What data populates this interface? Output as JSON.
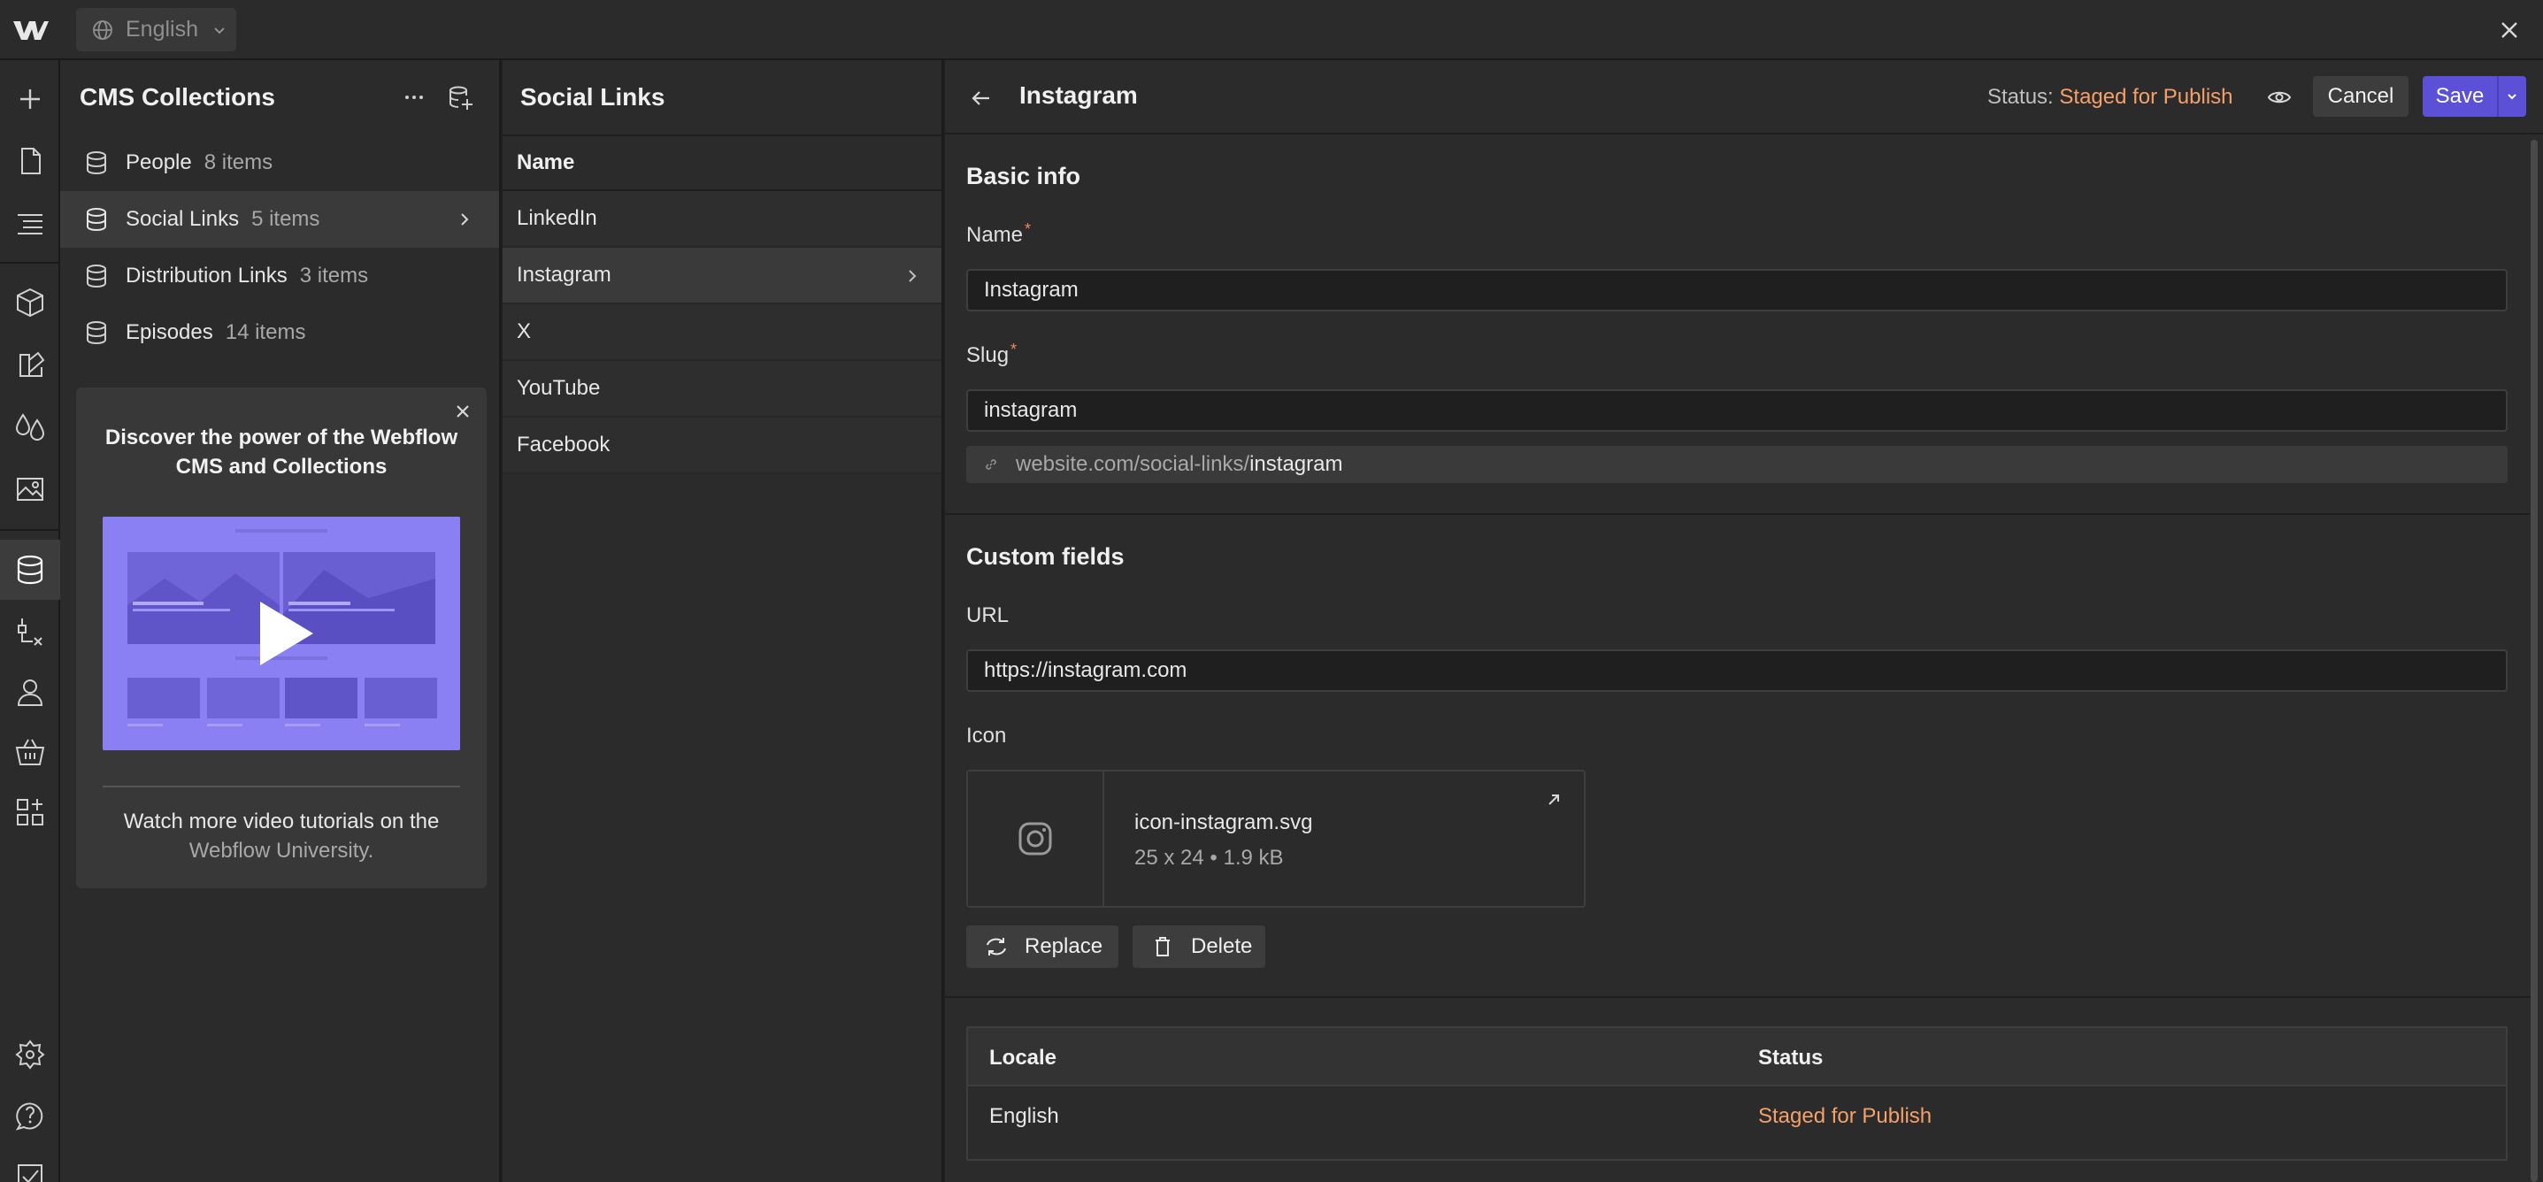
{
  "topbar": {
    "locale": "English"
  },
  "collections": {
    "title": "CMS Collections",
    "items": [
      {
        "name": "People",
        "count": "8 items"
      },
      {
        "name": "Social Links",
        "count": "5 items"
      },
      {
        "name": "Distribution Links",
        "count": "3 items"
      },
      {
        "name": "Episodes",
        "count": "14 items"
      }
    ],
    "promo": {
      "title": "Discover the power of the Webflow CMS and Collections",
      "footer_prefix": "Watch more video tutorials on the",
      "footer_link": "Webflow University."
    }
  },
  "items_panel": {
    "title": "Social Links",
    "column": "Name",
    "rows": [
      "LinkedIn",
      "Instagram",
      "X",
      "YouTube",
      "Facebook"
    ]
  },
  "editor": {
    "title": "Instagram",
    "status_label": "Status:",
    "status_value": "Staged for Publish",
    "cancel": "Cancel",
    "save": "Save",
    "basic_info": {
      "title": "Basic info",
      "name_label": "Name",
      "name_value": "Instagram",
      "slug_label": "Slug",
      "slug_value": "instagram",
      "url_prefix": "website.com/social-links/",
      "url_slug": "instagram"
    },
    "custom_fields": {
      "title": "Custom fields",
      "url_label": "URL",
      "url_value": "https://instagram.com",
      "icon_label": "Icon",
      "file_name": "icon-instagram.svg",
      "file_meta": "25 x 24 • 1.9 kB",
      "replace": "Replace",
      "delete": "Delete"
    },
    "locales": {
      "headers": [
        "Locale",
        "Status"
      ],
      "rows": [
        {
          "locale": "English",
          "status": "Staged for Publish"
        }
      ]
    }
  },
  "colors": {
    "accent": "#5b50d6",
    "status": "#f4a06a",
    "promo_video": "#8a80f4"
  }
}
